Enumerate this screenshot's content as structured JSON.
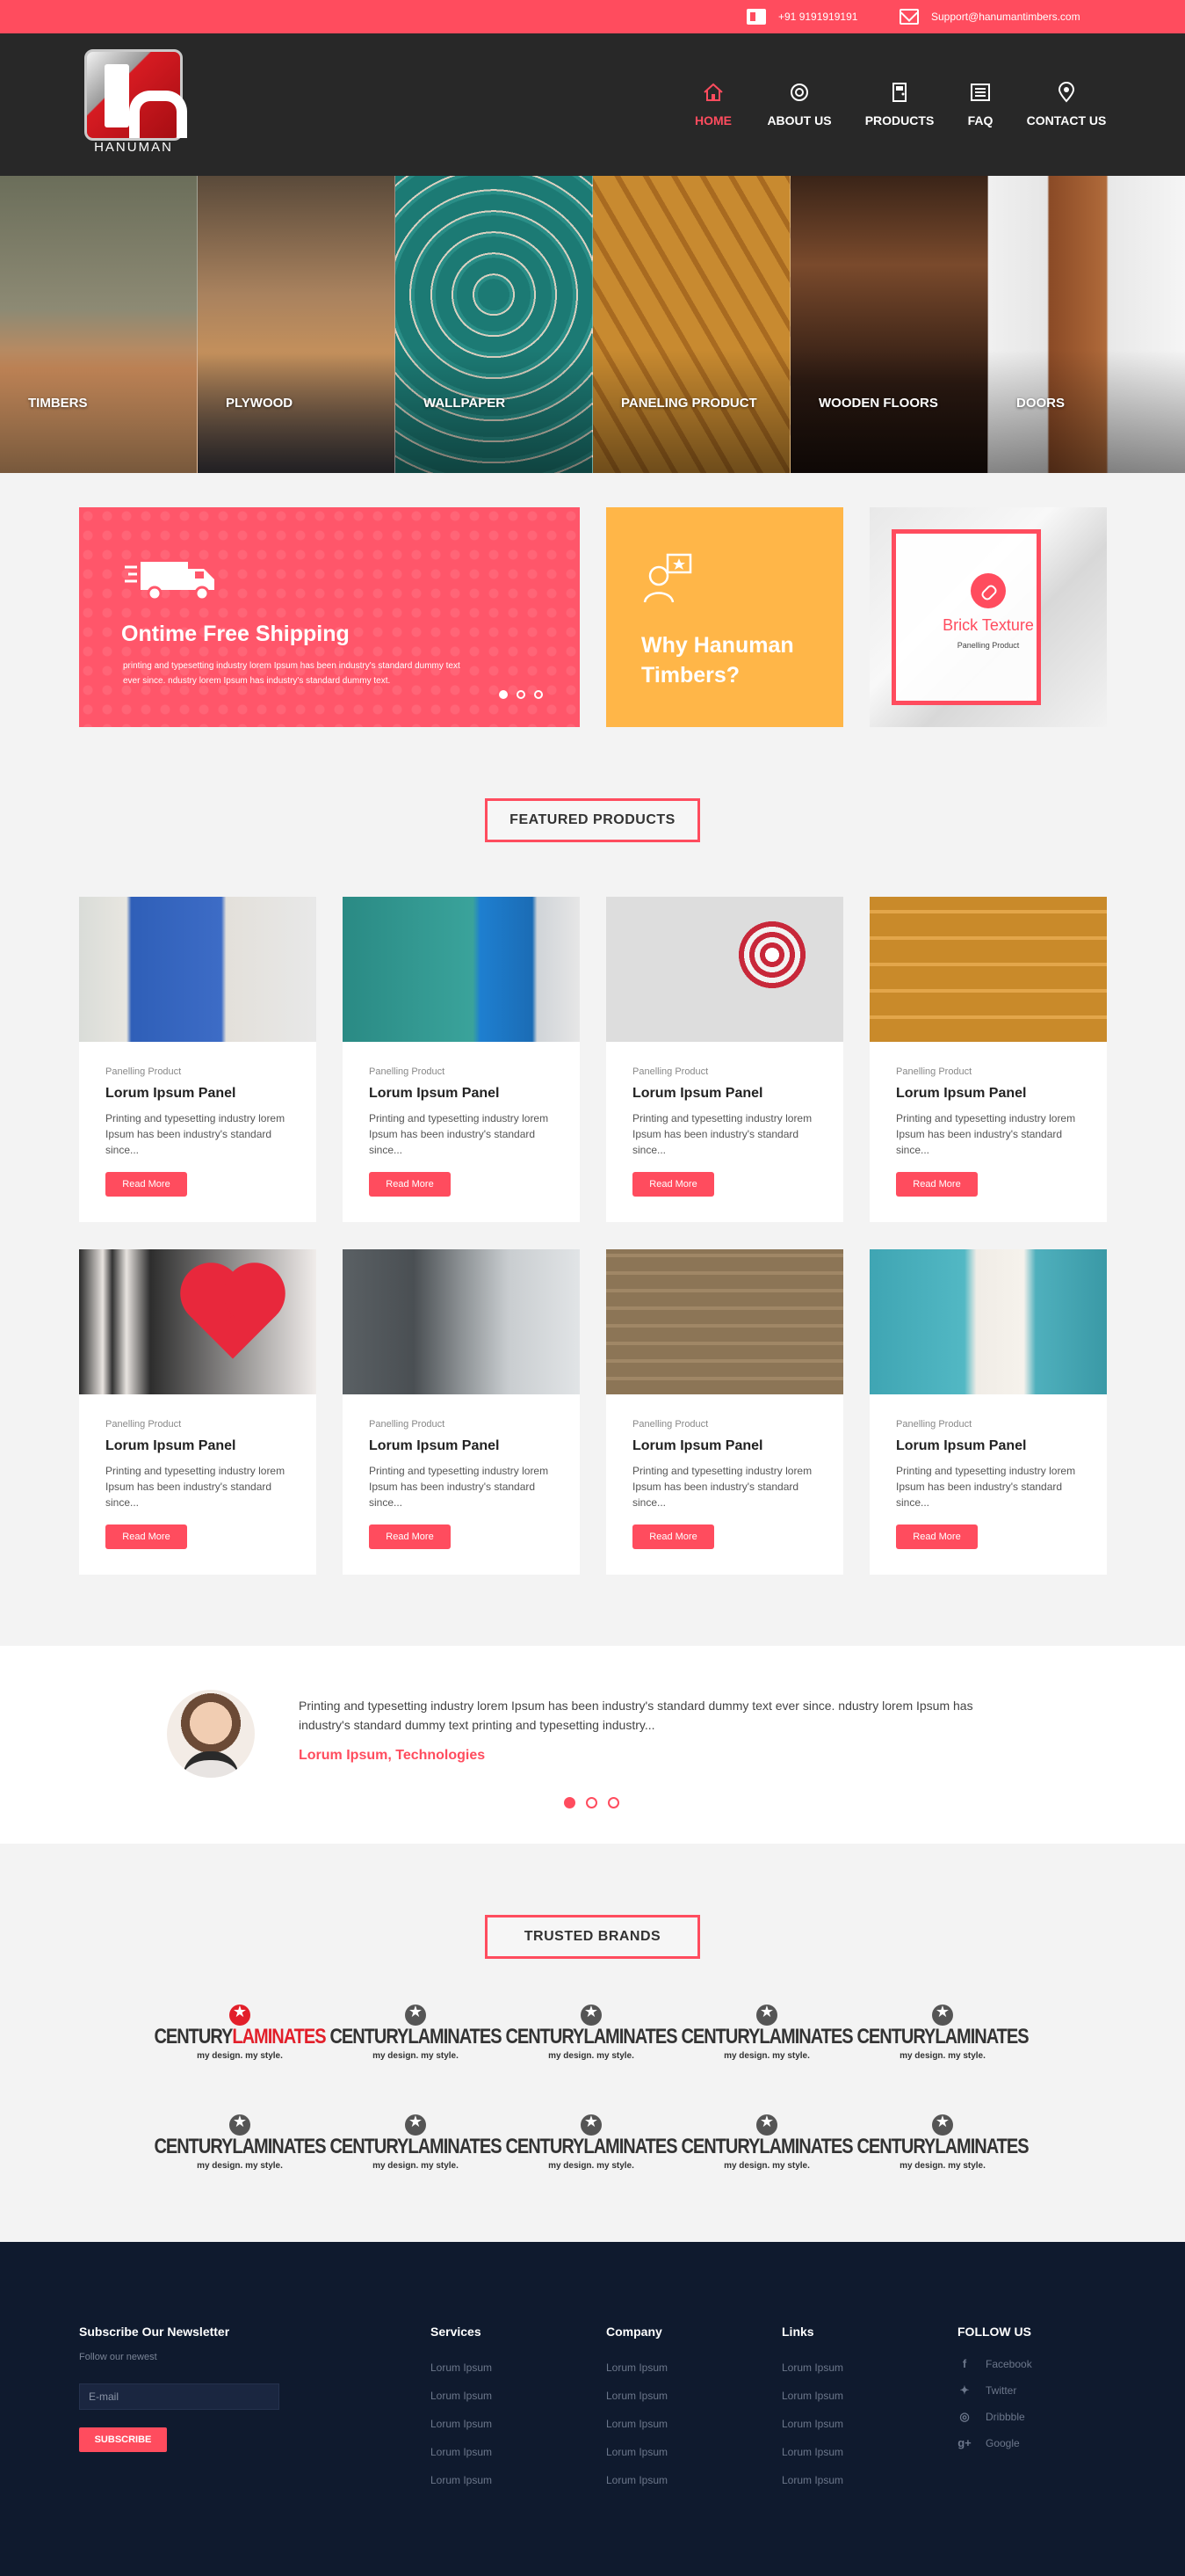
{
  "topbar": {
    "phone": "+91 9191919191",
    "email": "Support@hanumantimbers.com"
  },
  "logo": {
    "text": "HANUMAN"
  },
  "nav": [
    {
      "label": "HOME",
      "icon": "home-icon",
      "active": true
    },
    {
      "label": "ABOUT US",
      "icon": "about-icon",
      "active": false
    },
    {
      "label": "PRODUCTS",
      "icon": "door-icon",
      "active": false
    },
    {
      "label": "FAQ",
      "icon": "list-icon",
      "active": false
    },
    {
      "label": "CONTACT US",
      "icon": "location-pin-icon",
      "active": false
    }
  ],
  "categories": [
    {
      "label": "TIMBERS"
    },
    {
      "label": "PLYWOOD"
    },
    {
      "label": "WALLPAPER"
    },
    {
      "label": "PANELING PRODUCT"
    },
    {
      "label": "WOODEN FLOORS"
    },
    {
      "label": "DOORS"
    }
  ],
  "features": {
    "shipping": {
      "title": "Ontime Free Shipping",
      "text": "printing and typesetting industry lorem Ipsum has been industry's standard dummy text ever since. ndustry lorem Ipsum has industry's standard dummy text."
    },
    "why": {
      "title": "Why Hanuman Timbers?"
    },
    "brick": {
      "title": "Brick Texture",
      "subtitle": "Panelling Product"
    }
  },
  "featured": {
    "title": "FEATURED PRODUCTS",
    "products": [
      {
        "category": "Panelling Product",
        "name": "Lorum Ipsum Panel",
        "desc": "Printing and typesetting industry lorem Ipsum has been industry's standard since...",
        "button": "Read More"
      },
      {
        "category": "Panelling Product",
        "name": "Lorum Ipsum Panel",
        "desc": "Printing and typesetting industry lorem Ipsum has been industry's standard since...",
        "button": "Read More"
      },
      {
        "category": "Panelling Product",
        "name": "Lorum Ipsum Panel",
        "desc": "Printing and typesetting industry lorem Ipsum has been industry's standard since...",
        "button": "Read More"
      },
      {
        "category": "Panelling Product",
        "name": "Lorum Ipsum Panel",
        "desc": "Printing and typesetting industry lorem Ipsum has been industry's standard since...",
        "button": "Read More"
      },
      {
        "category": "Panelling Product",
        "name": "Lorum Ipsum Panel",
        "desc": "Printing and typesetting industry lorem Ipsum has been industry's standard since...",
        "button": "Read More"
      },
      {
        "category": "Panelling Product",
        "name": "Lorum Ipsum Panel",
        "desc": "Printing and typesetting industry lorem Ipsum has been industry's standard since...",
        "button": "Read More"
      },
      {
        "category": "Panelling Product",
        "name": "Lorum Ipsum Panel",
        "desc": "Printing and typesetting industry lorem Ipsum has been industry's standard since...",
        "button": "Read More"
      },
      {
        "category": "Panelling Product",
        "name": "Lorum Ipsum Panel",
        "desc": "Printing and typesetting industry lorem Ipsum has been industry's standard since...",
        "button": "Read More"
      }
    ]
  },
  "testimonial": {
    "quote": "Printing and typesetting industry lorem Ipsum has been industry's standard dummy text ever since. ndustry lorem Ipsum has industry's standard dummy text printing and typesetting industry...",
    "author": "Lorum Ipsum, Technologies"
  },
  "brands": {
    "title": "TRUSTED BRANDS",
    "items": [
      {
        "name_a": "CENTURY",
        "name_b": "LAMINATES",
        "tagline": "my design. my style."
      },
      {
        "name_a": "CENTURY",
        "name_b": "LAMINATES",
        "tagline": "my design. my style."
      },
      {
        "name_a": "CENTURY",
        "name_b": "LAMINATES",
        "tagline": "my design. my style."
      },
      {
        "name_a": "CENTURY",
        "name_b": "LAMINATES",
        "tagline": "my design. my style."
      },
      {
        "name_a": "CENTURY",
        "name_b": "LAMINATES",
        "tagline": "my design. my style."
      },
      {
        "name_a": "CENTURY",
        "name_b": "LAMINATES",
        "tagline": "my design. my style."
      },
      {
        "name_a": "CENTURY",
        "name_b": "LAMINATES",
        "tagline": "my design. my style."
      },
      {
        "name_a": "CENTURY",
        "name_b": "LAMINATES",
        "tagline": "my design. my style."
      },
      {
        "name_a": "CENTURY",
        "name_b": "LAMINATES",
        "tagline": "my design. my style."
      },
      {
        "name_a": "CENTURY",
        "name_b": "LAMINATES",
        "tagline": "my design. my style."
      }
    ]
  },
  "footer": {
    "newsletter": {
      "title": "Subscribe Our Newsletter",
      "subtitle": "Follow our newest",
      "placeholder": "E-mail",
      "button": "SUBSCRIBE"
    },
    "services": {
      "title": "Services",
      "items": [
        "Lorum Ipsum",
        "Lorum Ipsum",
        "Lorum Ipsum",
        "Lorum Ipsum",
        "Lorum Ipsum"
      ]
    },
    "company": {
      "title": "Company",
      "items": [
        "Lorum Ipsum",
        "Lorum Ipsum",
        "Lorum Ipsum",
        "Lorum Ipsum",
        "Lorum Ipsum"
      ]
    },
    "links": {
      "title": "Links",
      "items": [
        "Lorum Ipsum",
        "Lorum Ipsum",
        "Lorum Ipsum",
        "Lorum Ipsum",
        "Lorum Ipsum"
      ]
    },
    "follow": {
      "title": "FOLLOW US",
      "items": [
        {
          "label": "Facebook",
          "icon": "facebook-icon"
        },
        {
          "label": "Twitter",
          "icon": "twitter-icon"
        },
        {
          "label": "Dribbble",
          "icon": "dribbble-icon"
        },
        {
          "label": "Google",
          "icon": "google-plus-icon"
        }
      ]
    }
  },
  "colors": {
    "accent": "#ff4c5e",
    "header_bg": "#282828",
    "footer_bg": "#0f1a2e",
    "yellow": "#ffb648"
  }
}
